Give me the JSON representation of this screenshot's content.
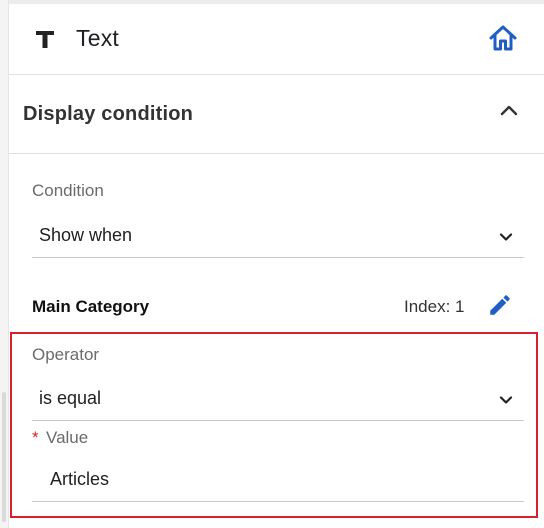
{
  "header": {
    "title": "Text",
    "type_icon": "text-type-icon",
    "home_icon": "home-icon",
    "accent_color": "#1f5fc5"
  },
  "display_condition": {
    "title": "Display condition",
    "collapse_icon": "chevron-up-icon",
    "condition": {
      "label": "Condition",
      "value": "Show when"
    },
    "rule": {
      "field_name": "Main Category",
      "index_label": "Index: 1",
      "edit_icon": "pencil-icon",
      "operator": {
        "label": "Operator",
        "value": "is equal"
      },
      "value_field": {
        "required_mark": "*",
        "label": "Value",
        "value": "Articles"
      }
    }
  },
  "highlight_color": "#d8202a"
}
